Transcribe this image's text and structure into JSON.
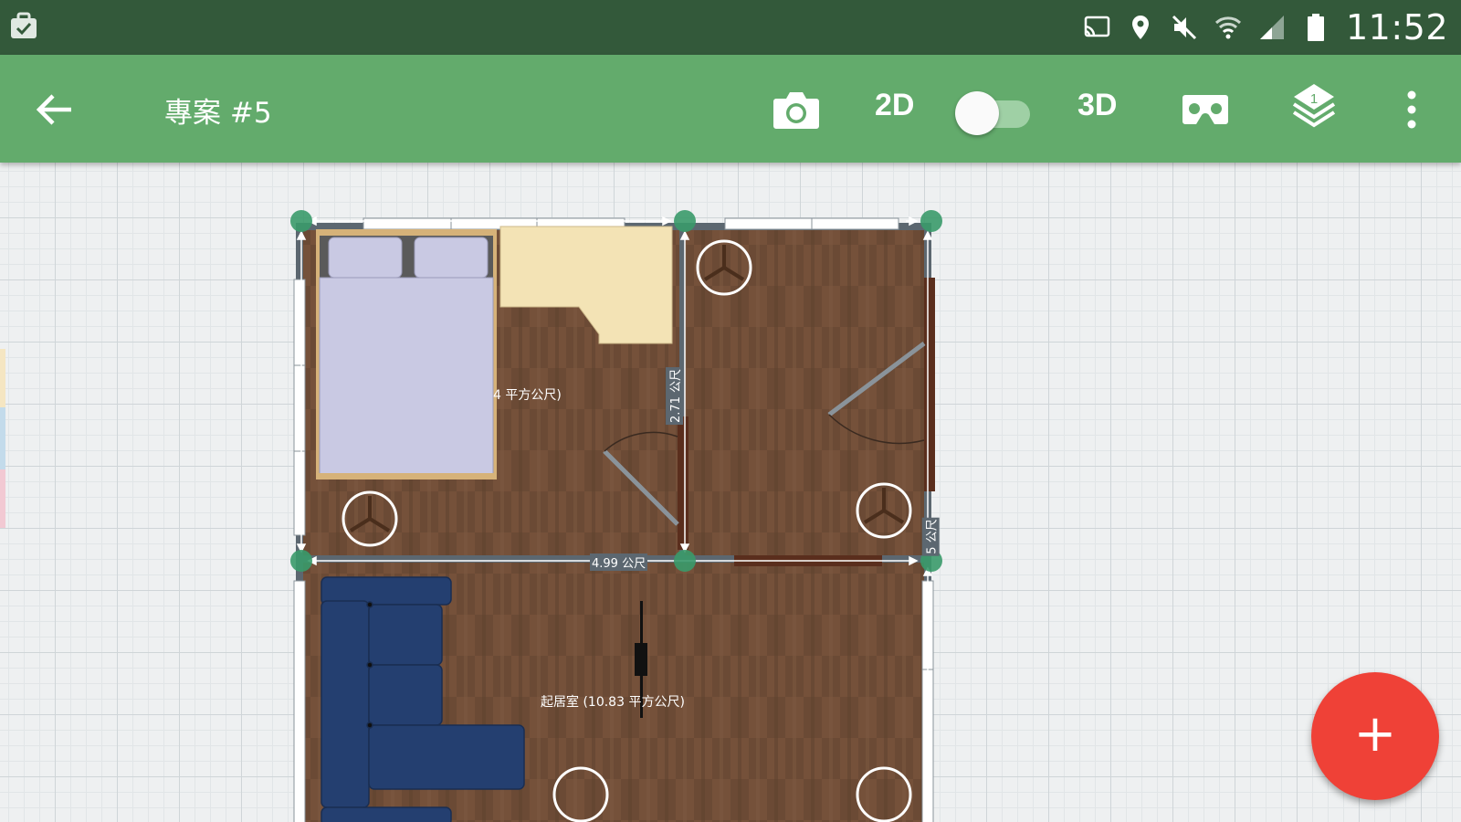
{
  "status_bar": {
    "time": "11:52",
    "left_icon": "briefcase-check-icon",
    "icons": [
      "cast-icon",
      "location-pin-icon",
      "mute-icon",
      "wifi-icon",
      "signal-icon",
      "battery-icon"
    ]
  },
  "app_bar": {
    "title": "專案 #5",
    "mode_2d": "2D",
    "mode_3d": "3D",
    "layer_number": "1",
    "colors": {
      "primary": "#63ab6c",
      "status": "#33593a",
      "accent": "#ef4137"
    },
    "toggle_on_3d": false
  },
  "plan": {
    "bedroom_area_label": "4 平方公尺)",
    "living_room_label": "起居室 (10.83 平方公尺)",
    "dimensions": {
      "horizontal_wall": "4.99 公尺",
      "vertical_wall": "2.71 公尺",
      "right_wall": "5 公尺"
    },
    "colors": {
      "floor": "#6b4a35",
      "wall": "#5c6770",
      "bed": "#c9c9e3",
      "desk": "#f3e3b5",
      "sofa": "#243f70",
      "node": "#3a9a6a"
    }
  },
  "fab": {
    "label": "+"
  }
}
